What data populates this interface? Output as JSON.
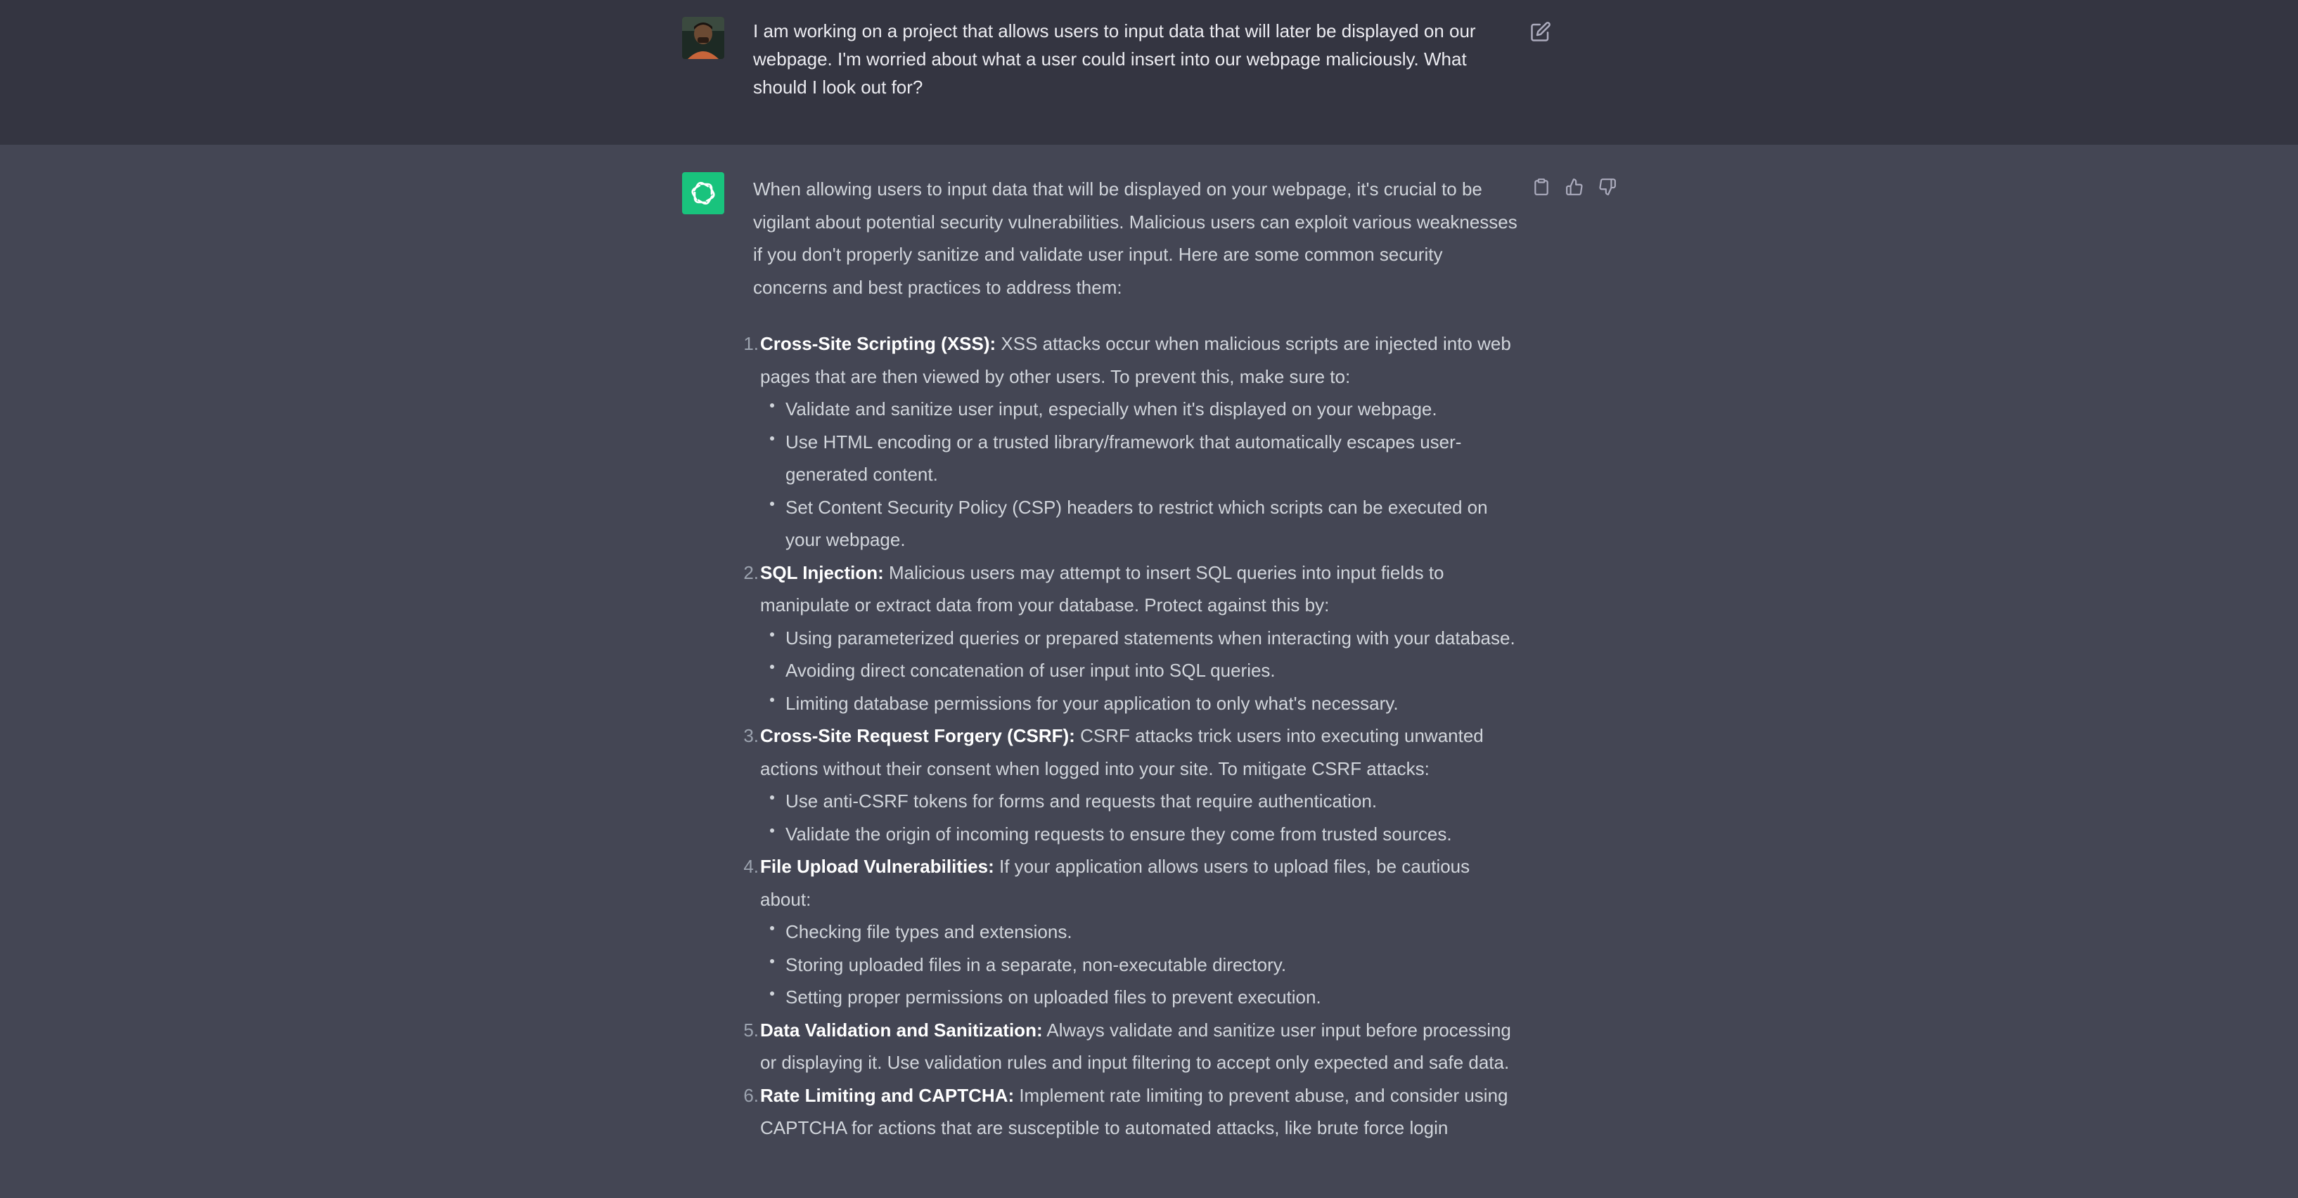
{
  "user_message": {
    "text": "I am working on a project that allows users to input data that will later be displayed on our webpage. I'm worried about what a user could insert into our webpage maliciously.  What should I look out for?"
  },
  "assistant_message": {
    "intro": "When allowing users to input data that will be displayed on your webpage, it's crucial to be vigilant about potential security vulnerabilities. Malicious users can exploit various weaknesses if you don't properly sanitize and validate user input. Here are some common security concerns and best practices to address them:",
    "items": [
      {
        "number": "1.",
        "title": "Cross-Site Scripting (XSS):",
        "text": " XSS attacks occur when malicious scripts are injected into web pages that are then viewed by other users. To prevent this, make sure to:",
        "bullets": [
          "Validate and sanitize user input, especially when it's displayed on your webpage.",
          "Use HTML encoding or a trusted library/framework that automatically escapes user-generated content.",
          "Set Content Security Policy (CSP) headers to restrict which scripts can be executed on your webpage."
        ]
      },
      {
        "number": "2.",
        "title": "SQL Injection:",
        "text": " Malicious users may attempt to insert SQL queries into input fields to manipulate or extract data from your database. Protect against this by:",
        "bullets": [
          "Using parameterized queries or prepared statements when interacting with your database.",
          "Avoiding direct concatenation of user input into SQL queries.",
          "Limiting database permissions for your application to only what's necessary."
        ]
      },
      {
        "number": "3.",
        "title": "Cross-Site Request Forgery (CSRF):",
        "text": " CSRF attacks trick users into executing unwanted actions without their consent when logged into your site. To mitigate CSRF attacks:",
        "bullets": [
          "Use anti-CSRF tokens for forms and requests that require authentication.",
          "Validate the origin of incoming requests to ensure they come from trusted sources."
        ]
      },
      {
        "number": "4.",
        "title": "File Upload Vulnerabilities:",
        "text": " If your application allows users to upload files, be cautious about:",
        "bullets": [
          "Checking file types and extensions.",
          "Storing uploaded files in a separate, non-executable directory.",
          "Setting proper permissions on uploaded files to prevent execution."
        ]
      },
      {
        "number": "5.",
        "title": "Data Validation and Sanitization:",
        "text": " Always validate and sanitize user input before processing or displaying it. Use validation rules and input filtering to accept only expected and safe data.",
        "bullets": []
      },
      {
        "number": "6.",
        "title": "Rate Limiting and CAPTCHA:",
        "text": " Implement rate limiting to prevent abuse, and consider using CAPTCHA for actions that are susceptible to automated attacks, like brute force login",
        "bullets": []
      }
    ]
  },
  "icons": {
    "edit": "edit-icon",
    "copy": "clipboard-icon",
    "like": "thumbs-up-icon",
    "dislike": "thumbs-down-icon",
    "assistant_logo": "openai-logo-icon",
    "user_avatar": "user-avatar"
  },
  "colors": {
    "user_bg": "#343541",
    "assistant_bg": "#444654",
    "logo_bg": "#19c37d"
  }
}
